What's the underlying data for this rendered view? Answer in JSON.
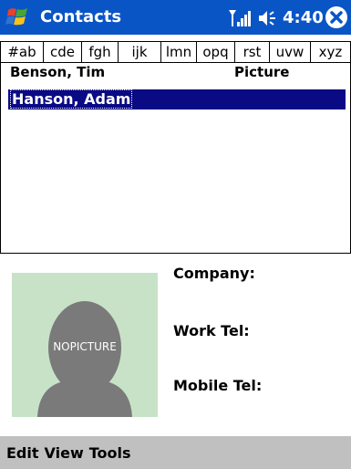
{
  "titlebar": {
    "app_title": "Contacts",
    "clock": "4:40",
    "bg_color": "#0a55c6"
  },
  "alpha_tabs": [
    {
      "label": "#ab"
    },
    {
      "label": "cde"
    },
    {
      "label": "fgh"
    },
    {
      "label": "ijk"
    },
    {
      "label": "lmn"
    },
    {
      "label": "opq"
    },
    {
      "label": "rst"
    },
    {
      "label": "uvw"
    },
    {
      "label": "xyz"
    }
  ],
  "list": {
    "header_name": "Benson, Tim",
    "header_picture": "Picture",
    "selected_row": "Hanson, Adam",
    "selection_color": "#0a0a85"
  },
  "detail": {
    "picture_placeholder": "NOPICTURE",
    "company_label": "Company:",
    "work_tel_label": "Work Tel:",
    "mobile_tel_label": "Mobile Tel:"
  },
  "menubar": {
    "items": [
      "Edit",
      "View",
      "Tools"
    ]
  },
  "icons": [
    "windows-start-icon",
    "signal-icon",
    "volume-icon",
    "close-icon",
    "person-silhouette-icon"
  ]
}
